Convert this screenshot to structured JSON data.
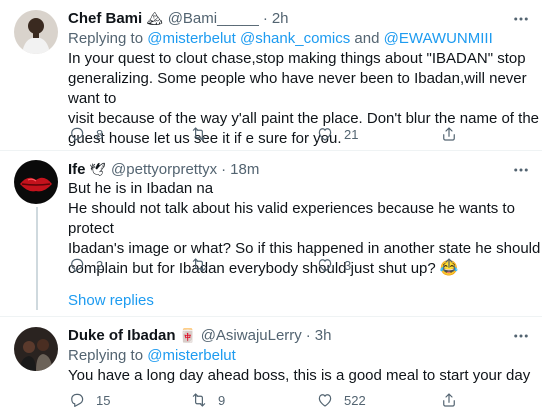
{
  "tweets": [
    {
      "name": "Chef Bami",
      "name_emoji": "🏔",
      "handle": "@Bami_____",
      "time": "2h",
      "replying_prefix": "Replying to ",
      "replying_links": [
        "@misterbelut",
        "@shank_comics",
        "@EWAWUNMIII"
      ],
      "replying_and": " and ",
      "text_lines": [
        "In your quest to clout chase,stop making things about \"IBADAN\" stop",
        "generalizing. Some people who have never been to Ibadan,will never want to",
        "visit because of the way y'all paint the place. Don't blur the name of the",
        "guest house let us see it if e sure for you."
      ],
      "replies": "8",
      "retweets": "",
      "likes": "21"
    },
    {
      "name": "Ife",
      "name_emoji": "🕊",
      "handle": "@pettyorprettyx",
      "time": "18m",
      "text_lines": [
        "But he is in Ibadan na",
        "He should not talk about his valid experiences because he wants to protect",
        "Ibadan's image or what? So if this happened in another state he should",
        "complain but for Ibadan everybody should just shut up? 😂"
      ],
      "replies": "2",
      "retweets": "",
      "likes": "3"
    },
    {
      "name": "Duke of Ibadan",
      "name_emoji": "🀄",
      "handle": "@AsiwajuLerry",
      "time": "3h",
      "replying_prefix": "Replying to ",
      "replying_links": [
        "@misterbelut"
      ],
      "text_lines": [
        "You have a long day ahead boss, this is a good meal to start your day"
      ],
      "replies": "15",
      "retweets": "9",
      "likes": "522"
    }
  ],
  "show_replies": "Show replies",
  "dot": "·",
  "colors": {
    "link": "#1d9bf0",
    "muted": "#536471",
    "text": "#0f1419",
    "border": "#eff3f4"
  },
  "icons": [
    "reply-icon",
    "retweet-icon",
    "like-icon",
    "share-icon",
    "more-icon"
  ]
}
